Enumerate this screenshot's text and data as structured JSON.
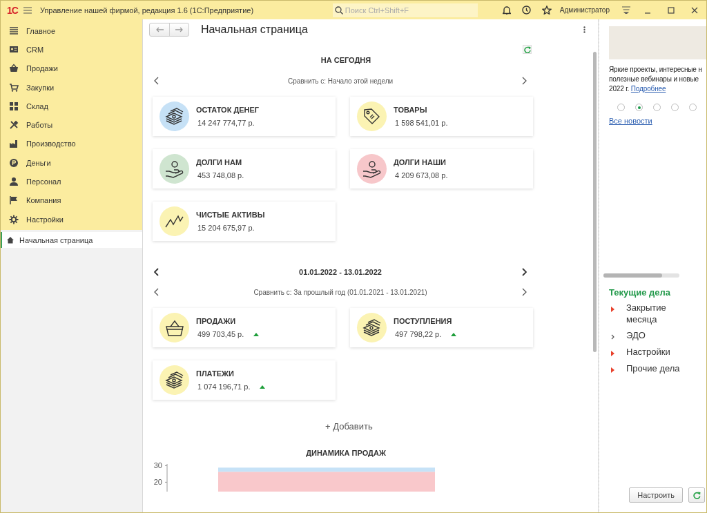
{
  "window": {
    "title": "Управление нашей фирмой, редакция 1.6  (1С:Предприятие)",
    "logo": "1С",
    "search": {
      "placeholder": "Поиск Ctrl+Shift+F"
    },
    "user": "Администратор"
  },
  "sidebar": {
    "items": [
      {
        "label": "Главное",
        "selected": false
      },
      {
        "label": "CRM",
        "selected": false
      },
      {
        "label": "Продажи",
        "selected": false
      },
      {
        "label": "Закупки",
        "selected": false
      },
      {
        "label": "Склад",
        "selected": false
      },
      {
        "label": "Работы",
        "selected": false
      },
      {
        "label": "Производство",
        "selected": false
      },
      {
        "label": "Деньги",
        "selected": false
      },
      {
        "label": "Персонал",
        "selected": false
      },
      {
        "label": "Компания",
        "selected": false
      },
      {
        "label": "Настройки",
        "selected": false
      }
    ],
    "open_pages": [
      {
        "label": "Начальная страница",
        "selected": true
      }
    ]
  },
  "page": {
    "title": "Начальная страница",
    "today": {
      "heading": "НА СЕГОДНЯ",
      "compare": "Сравнить с: Начало этой недели",
      "cards": [
        {
          "title": "ОСТАТОК ДЕНЕГ",
          "value": "14 247 774,77 р.",
          "color": "#c6e1f6"
        },
        {
          "title": "ТОВАРЫ",
          "value": "1 598 541,01 р.",
          "color": "#fbf3b3"
        },
        {
          "title": "ДОЛГИ НАМ",
          "value": "453 748,08 р.",
          "color": "#cfe5d0"
        },
        {
          "title": "ДОЛГИ НАШИ",
          "value": "4 209 673,08 р.",
          "color": "#f7c7ca"
        },
        {
          "title": "ЧИСТЫЕ АКТИВЫ",
          "value": "15 204 675,97 р.",
          "color": "#fbf3b3"
        }
      ]
    },
    "period": {
      "range": "01.01.2022 - 13.01.2022",
      "compare": "Сравнить с: За прошлый год (01.01.2021 - 13.01.2021)",
      "cards": [
        {
          "title": "ПРОДАЖИ",
          "value": "499 703,45 р.",
          "rising": true,
          "color": "#fbf3b3"
        },
        {
          "title": "ПОСТУПЛЕНИЯ",
          "value": "497 798,22 р.",
          "rising": true,
          "color": "#fbf3b3"
        },
        {
          "title": "ПЛАТЕЖИ",
          "value": "1 074 196,71 р.",
          "rising": true,
          "color": "#fbf3b3"
        }
      ]
    },
    "add_button": "+ Добавить",
    "sales_chart": {
      "title": "ДИНАМИКА ПРОДАЖ",
      "chart_data": {
        "type": "bar",
        "stacked": true,
        "ylim": [
          0,
          31
        ],
        "yticks": [
          20,
          30
        ],
        "series": [
          {
            "color": "#f9c8cb",
            "values": [
              26.3
            ]
          },
          {
            "color": "#c6e2f7",
            "values": [
              2.5
            ]
          }
        ]
      }
    }
  },
  "news": {
    "lines": [
      "Яркие проекты, интересные н",
      "полезные вебинары и новые",
      "2022 г."
    ],
    "link": "Подробнее",
    "pager": [
      {
        "selected": false
      },
      {
        "selected": true
      },
      {
        "selected": false
      },
      {
        "selected": false
      },
      {
        "selected": false
      }
    ],
    "all_link": "Все новости"
  },
  "tasks": {
    "heading": "Текущие дела",
    "items": [
      {
        "label": "Закрытие месяца",
        "kind": "alert"
      },
      {
        "label": "ЭДО",
        "kind": "plain"
      },
      {
        "label": "Настройки",
        "kind": "alert"
      },
      {
        "label": "Прочие дела",
        "kind": "alert"
      }
    ],
    "configure_button": "Настроить"
  }
}
